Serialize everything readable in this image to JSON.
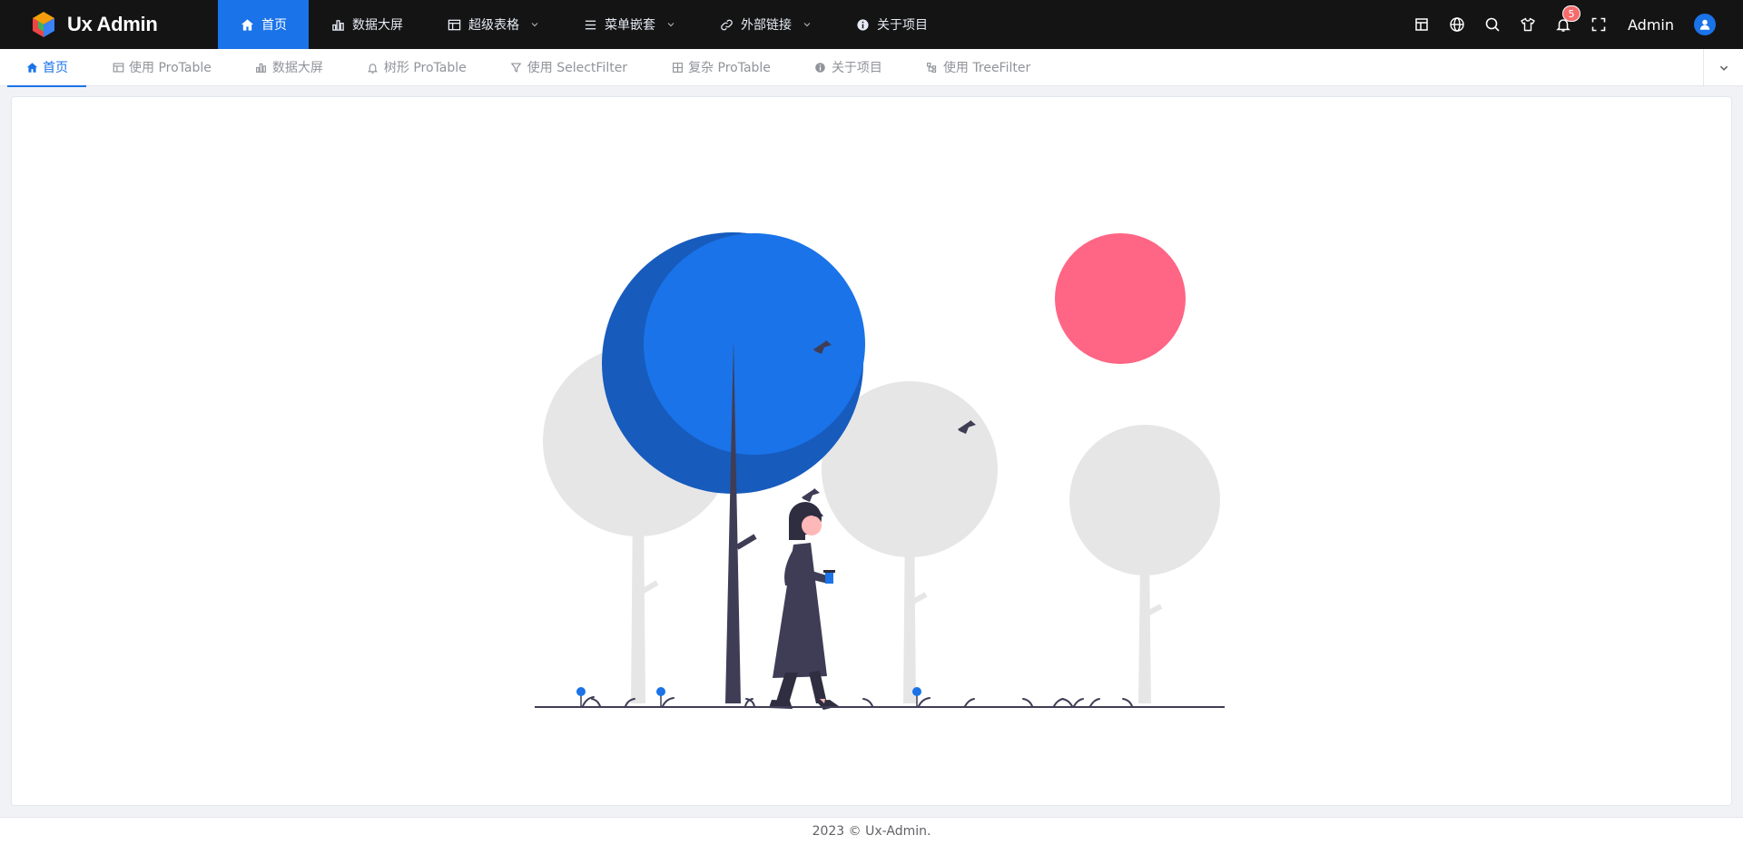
{
  "app": {
    "name": "Ux Admin"
  },
  "menu": [
    {
      "label": "首页",
      "icon": "home-icon",
      "active": true,
      "has_children": false
    },
    {
      "label": "数据大屏",
      "icon": "chart-icon",
      "active": false,
      "has_children": false
    },
    {
      "label": "超级表格",
      "icon": "table-icon",
      "active": false,
      "has_children": true
    },
    {
      "label": "菜单嵌套",
      "icon": "list-icon",
      "active": false,
      "has_children": true
    },
    {
      "label": "外部链接",
      "icon": "link-icon",
      "active": false,
      "has_children": true
    },
    {
      "label": "关于项目",
      "icon": "info-icon",
      "active": false,
      "has_children": false
    }
  ],
  "toolbar": {
    "notifications_count": "5",
    "username": "Admin",
    "icons": [
      "layout-icon",
      "globe-icon",
      "search-icon",
      "theme-shirt-icon",
      "bell-icon",
      "fullscreen-icon"
    ]
  },
  "tabs": [
    {
      "label": "首页",
      "icon": "home-icon",
      "active": true
    },
    {
      "label": "使用 ProTable",
      "icon": "table-icon",
      "active": false
    },
    {
      "label": "数据大屏",
      "icon": "chart-icon",
      "active": false
    },
    {
      "label": "树形 ProTable",
      "icon": "tree-bell-icon",
      "active": false
    },
    {
      "label": "使用 SelectFilter",
      "icon": "filter-icon",
      "active": false
    },
    {
      "label": "复杂 ProTable",
      "icon": "grid-icon",
      "active": false
    },
    {
      "label": "关于项目",
      "icon": "info-icon",
      "active": false
    },
    {
      "label": "使用 TreeFilter",
      "icon": "tree-icon",
      "active": false
    }
  ],
  "colors": {
    "primary": "#1a73e8",
    "header_bg": "#141414",
    "sun": "#ff6584",
    "foliage_gray": "#e6e6e6",
    "dark": "#3f3d56"
  },
  "footer": {
    "text": "2023 © Ux-Admin."
  }
}
